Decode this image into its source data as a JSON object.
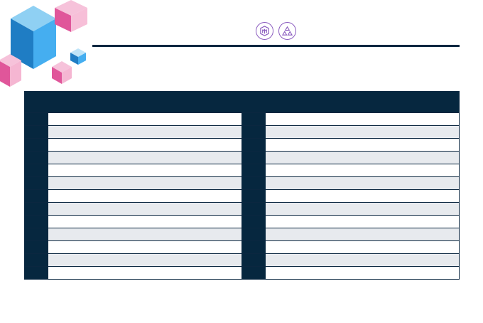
{
  "header": {
    "icons": [
      "maze-lab-icon",
      "recycle-badge-icon"
    ]
  },
  "table": {
    "heading": "",
    "rows": [
      {
        "left_num": "",
        "left_text": "",
        "right_num": "",
        "right_text": ""
      },
      {
        "left_num": "",
        "left_text": "",
        "right_num": "",
        "right_text": ""
      },
      {
        "left_num": "",
        "left_text": "",
        "right_num": "",
        "right_text": ""
      },
      {
        "left_num": "",
        "left_text": "",
        "right_num": "",
        "right_text": ""
      },
      {
        "left_num": "",
        "left_text": "",
        "right_num": "",
        "right_text": ""
      },
      {
        "left_num": "",
        "left_text": "",
        "right_num": "",
        "right_text": ""
      },
      {
        "left_num": "",
        "left_text": "",
        "right_num": "",
        "right_text": ""
      },
      {
        "left_num": "",
        "left_text": "",
        "right_num": "",
        "right_text": ""
      },
      {
        "left_num": "",
        "left_text": "",
        "right_num": "",
        "right_text": ""
      },
      {
        "left_num": "",
        "left_text": "",
        "right_num": "",
        "right_text": ""
      },
      {
        "left_num": "",
        "left_text": "",
        "right_num": "",
        "right_text": ""
      },
      {
        "left_num": "",
        "left_text": "",
        "right_num": "",
        "right_text": ""
      },
      {
        "left_num": "",
        "left_text": "",
        "right_num": "",
        "right_text": ""
      }
    ]
  },
  "colors": {
    "navy": "#06273f",
    "stripe": "#e7eaee",
    "blue_cube": "#2f8fd6",
    "pink_cube": "#e0569a",
    "icon_purple": "#8a5bbf"
  }
}
